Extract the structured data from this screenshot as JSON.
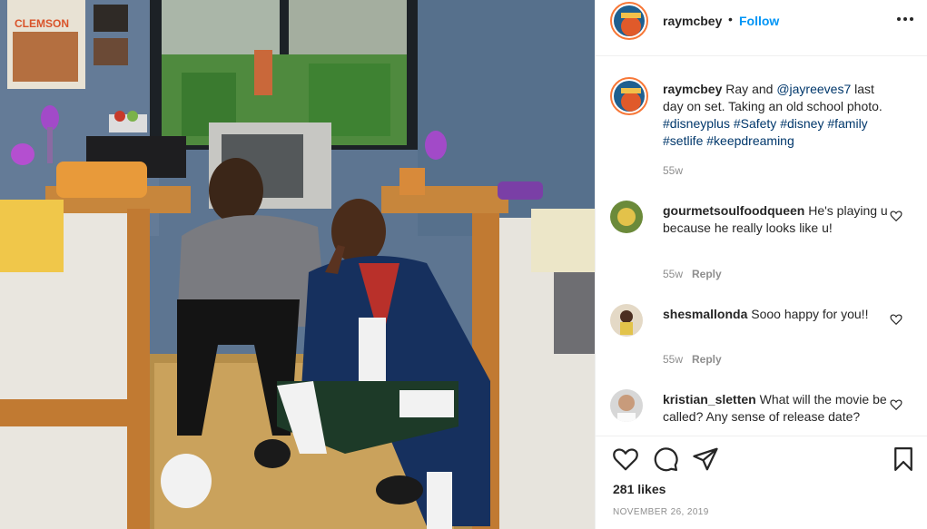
{
  "post": {
    "username": "raymcbey",
    "follow_label": "Follow",
    "separator": "•",
    "photo_description": "Two men posing in a dorm room set",
    "photo_poster_text": "CLEMSON",
    "caption": {
      "username": "raymcbey",
      "text_before": "Ray and ",
      "mention": "@jayreeves7",
      "text_after": " last day on set. Taking an old school photo. ",
      "hashtags": "#disneyplus #Safety #disney #family #setlife #keepdreaming",
      "time": "55w"
    },
    "comments": [
      {
        "username": "gourmetsoulfoodqueen",
        "text": "He's playing u because he really looks like u!",
        "time": "55w",
        "reply_label": "Reply"
      },
      {
        "username": "shesmallonda",
        "text": "Sooo happy for you!!",
        "time": "55w",
        "reply_label": "Reply"
      },
      {
        "username": "kristian_sletten",
        "text": "What will the movie be called? Any sense of release date?",
        "time": "",
        "reply_label": ""
      }
    ],
    "likes": "281 likes",
    "date": "NOVEMBER 26, 2019"
  },
  "icons": {
    "more": "more-options-icon",
    "like": "heart-icon",
    "comment": "comment-icon",
    "share": "share-icon",
    "save": "bookmark-icon"
  },
  "colors": {
    "link_blue": "#0095f6",
    "hashtag": "#00376b",
    "muted": "#8e8e8e",
    "border": "#efefef"
  }
}
